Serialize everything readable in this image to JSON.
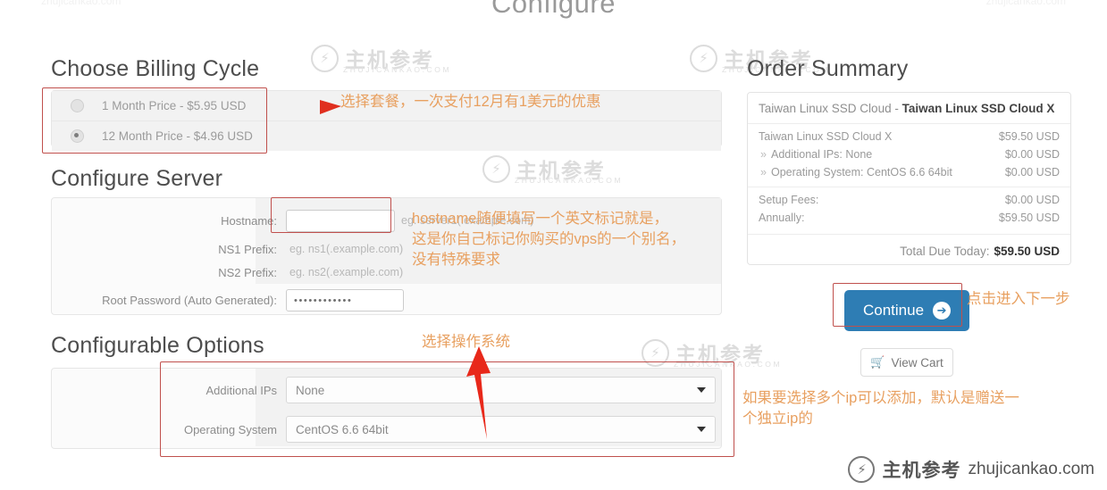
{
  "page": {
    "title": "Configure",
    "ghost_left": "zhujicankao.com",
    "ghost_right": "zhujicankao.com"
  },
  "watermark": {
    "cn": "主机参考",
    "sub": "ZHUJICANKAO.COM",
    "domain": "zhujicankao.com",
    "glyph": "⚡"
  },
  "billing": {
    "heading": "Choose Billing Cycle",
    "options": [
      {
        "label": "1 Month Price - $5.95 USD",
        "selected": false
      },
      {
        "label": "12 Month Price - $4.96 USD",
        "selected": true
      }
    ]
  },
  "configure_server": {
    "heading": "Configure Server",
    "fields": [
      {
        "label": "Hostname:",
        "value": "",
        "hint": "eg. server1(.example.com)",
        "type": "text"
      },
      {
        "label": "NS1 Prefix:",
        "value": "",
        "hint": "eg. ns1(.example.com)",
        "type": "hint-only"
      },
      {
        "label": "NS2 Prefix:",
        "value": "",
        "hint": "eg. ns2(.example.com)",
        "type": "hint-only"
      },
      {
        "label": "Root Password (Auto Generated):",
        "value": "••••••••••••",
        "hint": "",
        "type": "password"
      }
    ]
  },
  "configurable_options": {
    "heading": "Configurable Options",
    "options": [
      {
        "label": "Additional IPs",
        "value": "None"
      },
      {
        "label": "Operating System",
        "value": "CentOS 6.6 64bit"
      }
    ]
  },
  "order_summary": {
    "heading": "Order Summary",
    "product_prefix": "Taiwan Linux SSD Cloud - ",
    "product_name": "Taiwan Linux SSD Cloud X",
    "lines": [
      {
        "label": "Taiwan Linux SSD Cloud X",
        "amount": "$59.50 USD",
        "sub": false
      },
      {
        "label": "Additional IPs: None",
        "amount": "$0.00 USD",
        "sub": true
      },
      {
        "label": "Operating System: CentOS 6.6 64bit",
        "amount": "$0.00 USD",
        "sub": true
      }
    ],
    "fees": [
      {
        "label": "Setup Fees:",
        "amount": "$0.00 USD"
      },
      {
        "label": "Annually:",
        "amount": "$59.50 USD"
      }
    ],
    "total_label": "Total Due Today:",
    "total_amount": "$59.50 USD"
  },
  "actions": {
    "continue_label": "Continue",
    "continue_arrow": "➔",
    "view_cart_label": "View Cart",
    "cart_icon": "🛒"
  },
  "annotations": {
    "billing": "选择套餐，一次支付12月有1美元的优惠",
    "hostname": "hostname随便填写一个英文标记就是，\n这是你自己标记你购买的vps的一个别名，\n没有特殊要求",
    "os": "选择操作系统",
    "continue": "点击进入下一步",
    "additional_ips": "如果要选择多个ip可以添加，默认是赠送一\n个独立ip的"
  },
  "colors": {
    "accent_blue": "#2e7db4",
    "anno_orange": "#e8a060",
    "anno_red": "#c0504d",
    "arrow_red": "#e02f1f"
  }
}
